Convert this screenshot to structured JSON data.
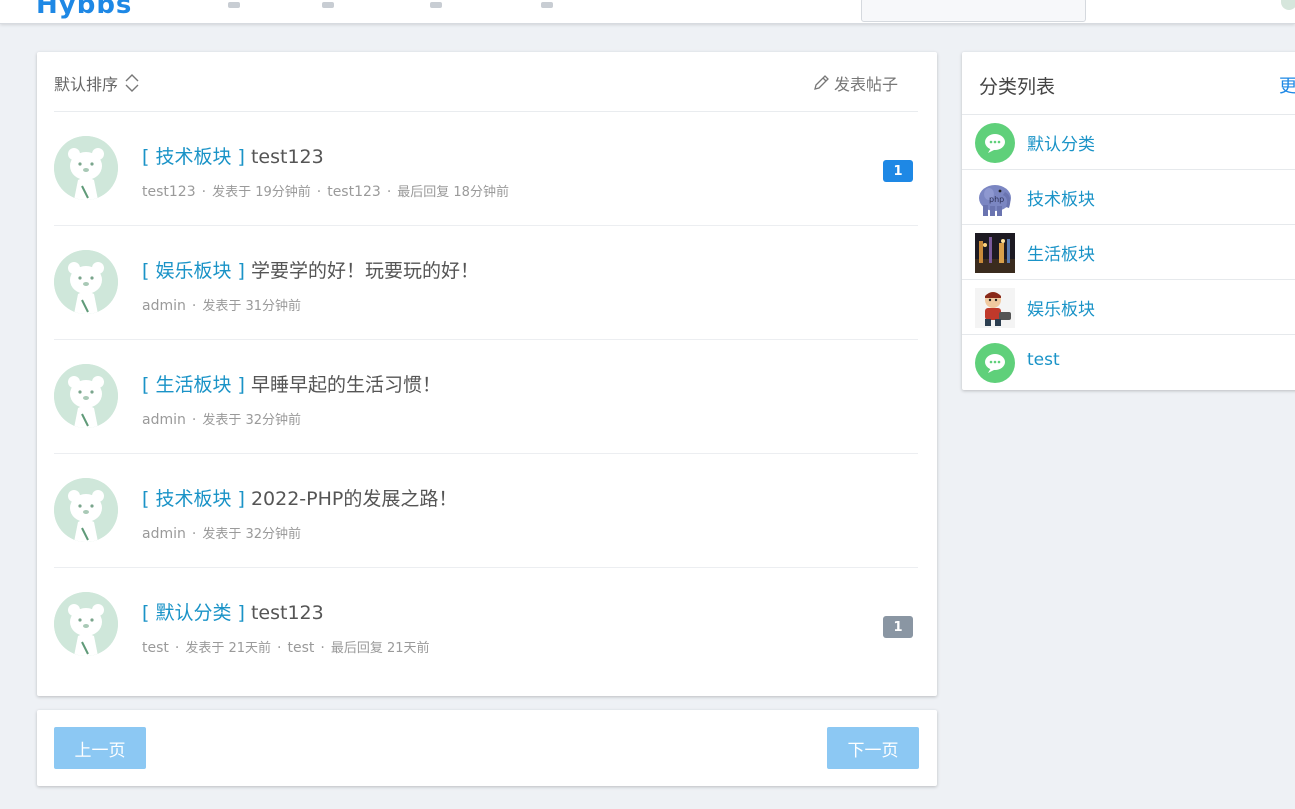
{
  "nav": {
    "logo": "Hybbs"
  },
  "list": {
    "sort_label": "默认排序",
    "compose_label": "发表帖子",
    "threads": [
      {
        "category": "[ 技术板块 ]",
        "title": "test123",
        "author": "test123",
        "posted": "发表于 19分钟前",
        "last_user": "test123",
        "last_reply": "最后回复 18分钟前",
        "replies": "1",
        "badge_color": "#1e88e5"
      },
      {
        "category": "[ 娱乐板块 ]",
        "title": "学要学的好！玩要玩的好！",
        "author": "admin",
        "posted": "发表于 31分钟前"
      },
      {
        "category": "[ 生活板块 ]",
        "title": "早睡早起的生活习惯！",
        "author": "admin",
        "posted": "发表于 32分钟前"
      },
      {
        "category": "[ 技术板块 ]",
        "title": "2022-PHP的发展之路！",
        "author": "admin",
        "posted": "发表于 32分钟前"
      },
      {
        "category": "[ 默认分类 ]",
        "title": "test123",
        "author": "test",
        "posted": "发表于 21天前",
        "last_user": "test",
        "last_reply": "最后回复 21天前",
        "replies": "1",
        "badge_color": "#8a96a3"
      }
    ]
  },
  "pager": {
    "prev_label": "上一页",
    "next_label": "下一页"
  },
  "sidebar": {
    "title": "分类列表",
    "more_label": "更",
    "categories": [
      {
        "label": "默认分类",
        "icon": "chat-bubble-icon"
      },
      {
        "label": "技术板块",
        "icon": "php-elephant-icon"
      },
      {
        "label": "生活板块",
        "icon": "night-street-photo-icon"
      },
      {
        "label": "娱乐板块",
        "icon": "cartoon-character-icon"
      },
      {
        "label": "test",
        "icon": "chat-bubble-icon"
      }
    ]
  },
  "colors": {
    "accent": "#1e88e5",
    "link": "#1a93c7",
    "button": "#8cc8f3",
    "avatar_bg": "#cfe7da"
  }
}
